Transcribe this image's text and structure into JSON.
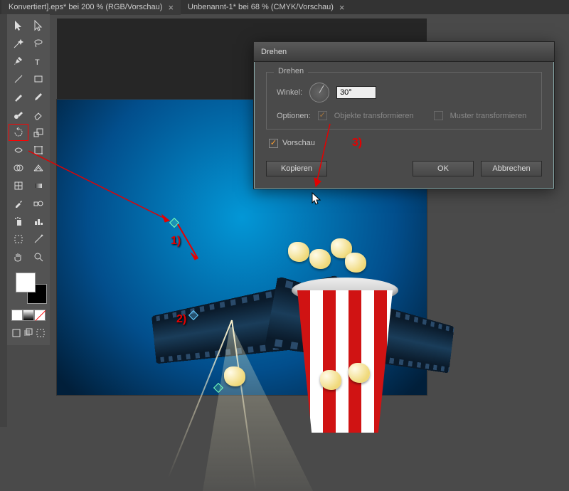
{
  "tabs": [
    {
      "label": "Konvertiert].eps* bei 200 % (RGB/Vorschau)"
    },
    {
      "label": "Unbenannt-1* bei 68 % (CMYK/Vorschau)"
    }
  ],
  "tools": {
    "row": [
      [
        "selection-tool",
        "direct-selection-tool"
      ],
      [
        "magic-wand-tool",
        "lasso-tool"
      ],
      [
        "pen-tool",
        "type-tool"
      ],
      [
        "line-segment-tool",
        "rectangle-tool"
      ],
      [
        "paintbrush-tool",
        "pencil-tool"
      ],
      [
        "blob-brush-tool",
        "eraser-tool"
      ],
      [
        "rotate-tool",
        "scale-tool"
      ],
      [
        "width-tool",
        "free-transform-tool"
      ],
      [
        "shape-builder-tool",
        "perspective-grid-tool"
      ],
      [
        "mesh-tool",
        "gradient-tool"
      ],
      [
        "eyedropper-tool",
        "blend-tool"
      ],
      [
        "symbol-sprayer-tool",
        "column-graph-tool"
      ],
      [
        "artboard-tool",
        "slice-tool"
      ],
      [
        "hand-tool",
        "zoom-tool"
      ]
    ],
    "selected": "rotate-tool"
  },
  "swatches": {
    "fill": "#ffffff",
    "stroke": "#000000"
  },
  "dialog": {
    "title": "Drehen",
    "fieldset_legend": "Drehen",
    "angle_label": "Winkel:",
    "angle_value": "30°",
    "options_label": "Optionen:",
    "opt_transform_objects": "Objekte transformieren",
    "opt_transform_patterns": "Muster transformieren",
    "preview_label": "Vorschau",
    "buttons": {
      "copy": "Kopieren",
      "ok": "OK",
      "cancel": "Abbrechen"
    }
  },
  "annotations": {
    "a1": "1)",
    "a2": "2)",
    "a3": "3)"
  }
}
